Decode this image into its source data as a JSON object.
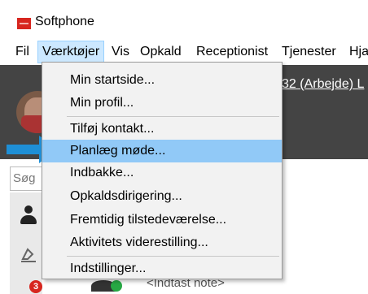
{
  "window": {
    "title": "Softphone",
    "logo_icon": "softphone-logo-icon",
    "accent_color": "#d7261f"
  },
  "menubar": {
    "items": [
      {
        "label": "Fil"
      },
      {
        "label": "Værktøjer",
        "active": true
      },
      {
        "label": "Vis"
      },
      {
        "label": "Opkald"
      },
      {
        "label": "Receptionist"
      },
      {
        "label": "Tjenester"
      },
      {
        "label": "Hja"
      }
    ]
  },
  "header": {
    "link_text": "32 (Arbejde) L"
  },
  "dropdown": {
    "items": [
      {
        "label": "Min startside..."
      },
      {
        "label": "Min profil..."
      },
      {
        "label": "Tilføj kontakt..."
      },
      {
        "label": "Planlæg møde...",
        "highlighted": true
      },
      {
        "label": "Indbakke..."
      },
      {
        "label": "Opkaldsdirigering..."
      },
      {
        "label": "Fremtidig tilstedeværelse..."
      },
      {
        "label": "Aktivitets viderestilling..."
      },
      {
        "label": "Indstillinger..."
      }
    ],
    "highlight_color": "#91c9f7"
  },
  "search": {
    "placeholder": "Søg"
  },
  "sidebar": {
    "icons": [
      "person-icon",
      "subscription-icon"
    ],
    "badge_count": "3"
  },
  "contact": {
    "note_placeholder": "<Indtast note>",
    "presence_color": "#27a844"
  },
  "annotation": {
    "arrow_color": "#1e8fd6"
  }
}
